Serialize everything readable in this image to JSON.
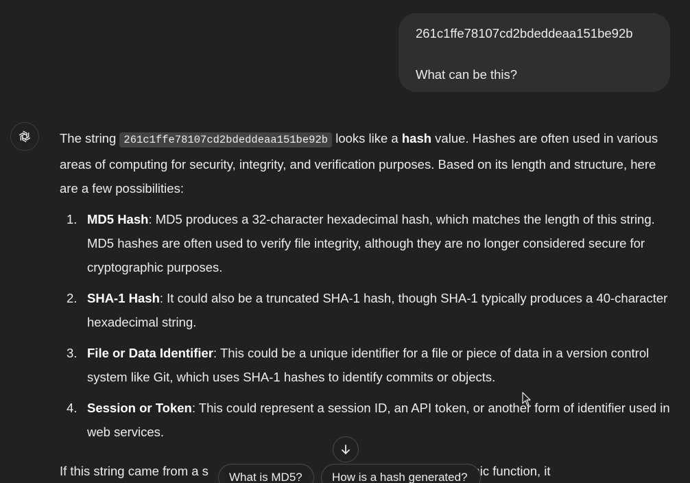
{
  "user_message": {
    "line1": "261c1ffe78107cd2bdeddeaa151be92b",
    "line2": "What can be this?"
  },
  "assistant": {
    "avatar_icon": "openai-logo-icon",
    "intro": {
      "before": "The string ",
      "code": "261c1ffe78107cd2bdeddeaa151be92b",
      "middle": " looks like a ",
      "bold": "hash",
      "after": " value. Hashes are often used in various areas of computing for security, integrity, and verification purposes. Based on its length and structure, here are a few possibilities:"
    },
    "items": [
      {
        "number": "1.",
        "title": "MD5 Hash",
        "text": ": MD5 produces a 32-character hexadecimal hash, which matches the length of this string. MD5 hashes are often used to verify file integrity, although they are no longer considered secure for cryptographic purposes."
      },
      {
        "number": "2.",
        "title": "SHA-1 Hash",
        "text": ": It could also be a truncated SHA-1 hash, though SHA-1 typically produces a 40-character hexadecimal string."
      },
      {
        "number": "3.",
        "title": "File or Data Identifier",
        "text": ": This could be a unique identifier for a file or piece of data in a version control system like Git, which uses SHA-1 hashes to identify commits or objects."
      },
      {
        "number": "4.",
        "title": "Session or Token",
        "text": ": This could represent a session ID, an API token, or another form of identifier used in web services."
      }
    ],
    "closing_partial": "If this string came from a s                                                          cryptographic function, it"
  },
  "suggestions": [
    "What is MD5?",
    "How is a hash generated?"
  ],
  "scroll_button_icon": "arrow-down-icon",
  "colors": {
    "background": "#212121",
    "user_bubble": "#2f2f2f",
    "text": "#ececec",
    "code_bg": "#424242"
  }
}
